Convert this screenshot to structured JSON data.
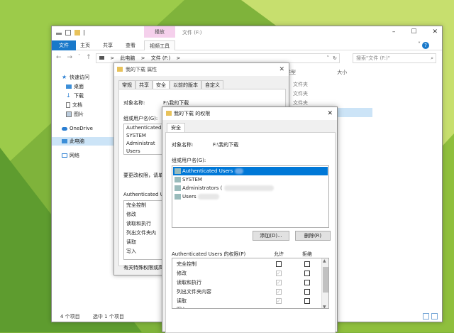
{
  "colors": {
    "accent": "#0078d7",
    "ribbon_file": "#1979ca",
    "context_tab": "#f5d0ec",
    "folder": "#e8c25a"
  },
  "explorer": {
    "context_tab": "播放",
    "title": "文件 (F:)",
    "ribbon_tabs": [
      "文件",
      "主页",
      "共享",
      "查看",
      "视频工具"
    ],
    "address": [
      "此电脑",
      ">",
      "文件 (F:)",
      ">"
    ],
    "search_placeholder": "搜索\"文件 (F:)\"",
    "columns": [
      "类型",
      "大小"
    ],
    "file_types": [
      "文件夹",
      "文件夹",
      "文件夹",
      "文件夹"
    ],
    "sidebar": [
      {
        "label": "快速访问",
        "icon": "star-icon"
      },
      {
        "label": "桌面",
        "icon": "desktop-icon"
      },
      {
        "label": "下载",
        "icon": "download-icon"
      },
      {
        "label": "文档",
        "icon": "document-icon"
      },
      {
        "label": "图片",
        "icon": "picture-icon"
      },
      {
        "label": "OneDrive",
        "icon": "cloud-icon"
      },
      {
        "label": "此电脑",
        "icon": "computer-icon"
      },
      {
        "label": "网络",
        "icon": "network-icon"
      }
    ],
    "status_count": "4 个项目",
    "status_selected": "选中 1 个项目"
  },
  "properties": {
    "title": "我的下载 属性",
    "tabs": [
      "常规",
      "共享",
      "安全",
      "以前的版本",
      "自定义"
    ],
    "object_label": "对象名称:",
    "object_value": "F:\\我的下载",
    "group_label": "组或用户名(G):",
    "users": [
      "Authenticated",
      "SYSTEM",
      "Administrat",
      "Users"
    ],
    "change_text": "要更改权限，请单",
    "perm_title": "Authenticated U",
    "permissions": [
      "完全控制",
      "修改",
      "读取和执行",
      "列出文件夹内",
      "读取",
      "写入"
    ],
    "special": "有关特殊权限或高"
  },
  "permissions_dialog": {
    "title": "我的下载 的权限",
    "tab": "安全",
    "object_label": "对象名称:",
    "object_value": "F:\\我的下载",
    "group_label": "组或用户名(G):",
    "users": [
      "Authenticated Users",
      "SYSTEM",
      "Administrators (",
      "Users"
    ],
    "add_button": "添加(D)...",
    "remove_button": "删除(R)",
    "perm_header": "Authenticated Users 的权限(P)",
    "allow": "允许",
    "deny": "拒绝",
    "permissions": [
      "完全控制",
      "修改",
      "读取和执行",
      "列出文件夹内容",
      "读取",
      "写入"
    ],
    "allowed": [
      false,
      true,
      true,
      true,
      true,
      true
    ]
  }
}
